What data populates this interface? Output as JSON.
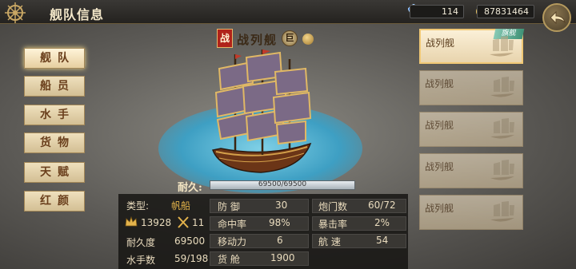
{
  "header": {
    "title": "舰队信息",
    "gems": "114",
    "coins": "87831464"
  },
  "menu": [
    {
      "label": "舰队",
      "active": true
    },
    {
      "label": "船员"
    },
    {
      "label": "水手"
    },
    {
      "label": "货物"
    },
    {
      "label": "天赋"
    },
    {
      "label": "红颜"
    }
  ],
  "ship": {
    "class_badge": "战",
    "name": "战列舰",
    "size_badge": "巨",
    "durability_label": "耐久:",
    "durability_text": "69500/69500",
    "durability_fraction": 1.0
  },
  "stats": {
    "type_label": "类型:",
    "type_value": "帆船",
    "crown_value": "13928",
    "swords_value": "11",
    "durability_label": "耐久度",
    "durability_value": "69500",
    "sailors_label": "水手数",
    "sailors_value": "59/198",
    "defense_label": "防 御",
    "defense_value": "30",
    "hit_label": "命中率",
    "hit_value": "98%",
    "move_label": "移动力",
    "move_value": "6",
    "cargo_label": "货 舱",
    "cargo_value": "1900",
    "cannons_label": "炮门数",
    "cannons_value": "60/72",
    "crit_label": "暴击率",
    "crit_value": "2%",
    "speed_label": "航 速",
    "speed_value": "54"
  },
  "fleet_slots": [
    {
      "label": "战列舰",
      "tag": "旗舰",
      "selected": true
    },
    {
      "label": "战列舰"
    },
    {
      "label": "战列舰"
    },
    {
      "label": "战列舰"
    },
    {
      "label": "战列舰"
    }
  ],
  "colors": {
    "accent_gold": "#e6b54a",
    "class_badge_red": "#b0231a",
    "flag_tag_green": "#3f9276"
  }
}
